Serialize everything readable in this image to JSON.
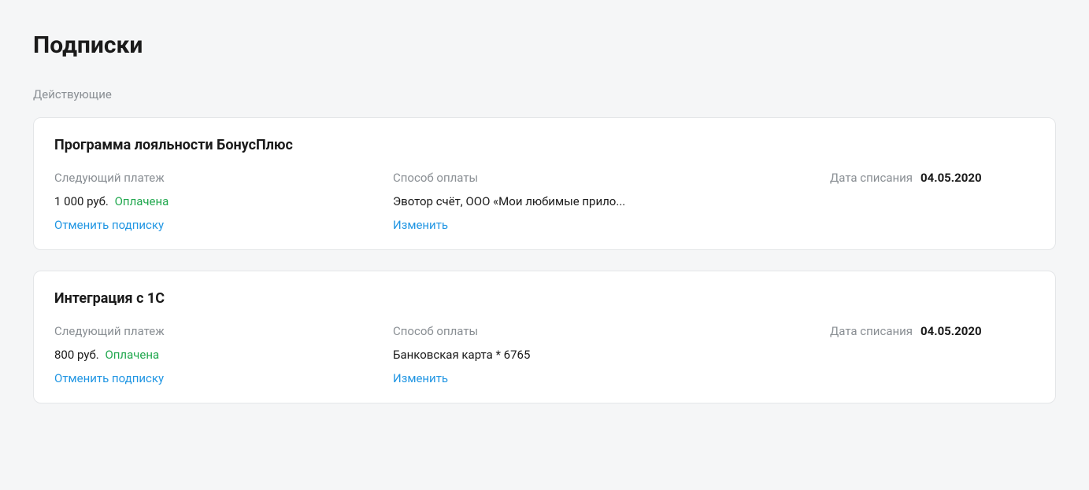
{
  "page": {
    "title": "Подписки",
    "section_label": "Действующие"
  },
  "labels": {
    "next_payment": "Следующий платеж",
    "payment_method": "Способ оплаты",
    "charge_date": "Дата списания",
    "cancel_subscription": "Отменить подписку",
    "change": "Изменить",
    "status_paid": "Оплачена"
  },
  "subscriptions": [
    {
      "title": "Программа лояльности БонусПлюс",
      "price": "1 000 руб.",
      "payment_method": "Эвотор счёт, ООО «Мои любимые прило...",
      "charge_date": "04.05.2020"
    },
    {
      "title": "Интеграция с 1С",
      "price": "800 руб.",
      "payment_method": "Банковская карта * 6765",
      "charge_date": "04.05.2020"
    }
  ]
}
